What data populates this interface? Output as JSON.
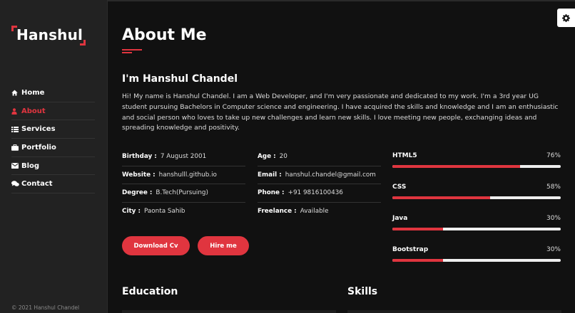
{
  "brand": {
    "name": "Hanshul",
    "accent": "#e0353f"
  },
  "sidebar": {
    "items": [
      {
        "label": "Home",
        "icon": "home-icon"
      },
      {
        "label": "About",
        "icon": "user-icon",
        "active": true
      },
      {
        "label": "Services",
        "icon": "list-icon"
      },
      {
        "label": "Portfolio",
        "icon": "briefcase-icon"
      },
      {
        "label": "Blog",
        "icon": "envelope-icon"
      },
      {
        "label": "Contact",
        "icon": "comments-icon"
      }
    ],
    "copyright": "© 2021 Hanshul Chandel"
  },
  "settings": {
    "icon": "gear-icon"
  },
  "about": {
    "title": "About Me",
    "heading": "I'm Hanshul Chandel",
    "intro": "Hi! My name is Hanshul Chandel. I am a Web Developer, and I'm very passionate and dedicated to my work. I'm a 3rd year UG student pursuing Bachelors in Computer science and engineering. I have acquired the skills and knowledge and I am an enthusiastic and social person who loves to take up new challenges and learn new skills. I love meeting new people, exchanging ideas and spreading knowledge and positivity.",
    "info_left": [
      {
        "label": "Birthday :",
        "value": "7 August 2001"
      },
      {
        "label": "Website :",
        "value": "hanshulll.github.io"
      },
      {
        "label": "Degree :",
        "value": "B.Tech(Pursuing)"
      },
      {
        "label": "City :",
        "value": "Paonta Sahib"
      }
    ],
    "info_right": [
      {
        "label": "Age :",
        "value": "20"
      },
      {
        "label": "Email :",
        "value": "hanshul.chandel@gmail.com"
      },
      {
        "label": "Phone :",
        "value": "+91 9816100436"
      },
      {
        "label": "Freelance :",
        "value": "Available"
      }
    ],
    "buttons": {
      "cv": "Download Cv",
      "hire": "Hire me"
    },
    "skills": [
      {
        "name": "HTML5",
        "percent_label": "76%",
        "percent": 76
      },
      {
        "name": "CSS",
        "percent_label": "58%",
        "percent": 58
      },
      {
        "name": "Java",
        "percent_label": "30%",
        "percent": 30
      },
      {
        "name": "Bootstrap",
        "percent_label": "30%",
        "percent": 30
      }
    ],
    "education_heading": "Education",
    "skills_heading": "Skills"
  }
}
